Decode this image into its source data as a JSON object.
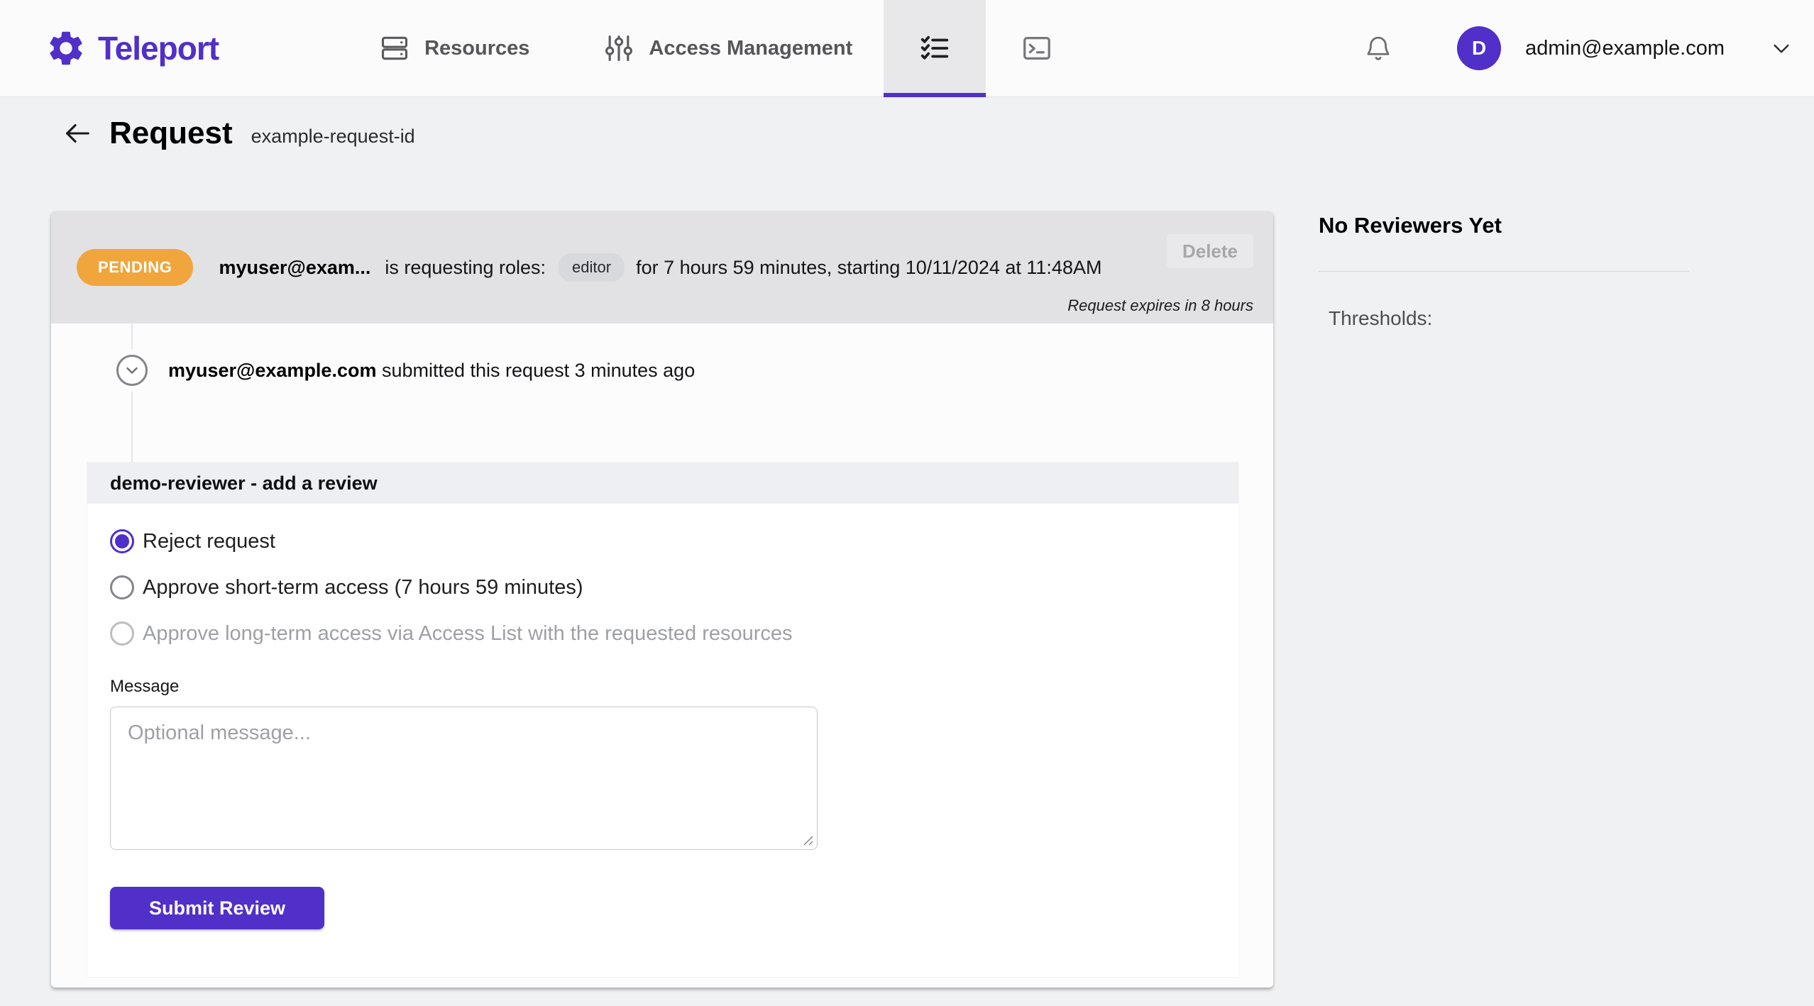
{
  "colors": {
    "brand": "#512FC9",
    "pending_badge": "#F0A63C"
  },
  "topnav": {
    "brand": "Teleport",
    "items": [
      {
        "label": "Resources",
        "icon": "servers-icon"
      },
      {
        "label": "Access Management",
        "icon": "sliders-icon"
      }
    ],
    "tabs": [
      {
        "icon": "checklist-icon",
        "selected": true
      },
      {
        "icon": "terminal-icon",
        "selected": false
      }
    ],
    "user": {
      "initial": "D",
      "email": "admin@example.com"
    }
  },
  "header": {
    "title": "Request",
    "request_id": "example-request-id"
  },
  "request": {
    "status": "PENDING",
    "requester_short": "myuser@exam...",
    "requesting_text": "is requesting roles:",
    "role": "editor",
    "duration_text": "for 7 hours 59 minutes, starting 10/11/2024 at 11:48AM",
    "delete_label": "Delete",
    "expires_text": "Request expires in 8 hours",
    "timeline": {
      "user": "myuser@example.com",
      "event": " submitted this request 3 minutes ago"
    }
  },
  "review": {
    "title": "demo-reviewer - add a review",
    "options": [
      {
        "label": "Reject request",
        "selected": true,
        "disabled": false
      },
      {
        "label": "Approve short-term access (7 hours 59 minutes)",
        "selected": false,
        "disabled": false
      },
      {
        "label": "Approve long-term access via Access List with the requested resources",
        "selected": false,
        "disabled": true
      }
    ],
    "message_label": "Message",
    "message_placeholder": "Optional message...",
    "submit_label": "Submit Review"
  },
  "reviewers": {
    "title": "No Reviewers Yet",
    "thresholds_label": "Thresholds:"
  }
}
